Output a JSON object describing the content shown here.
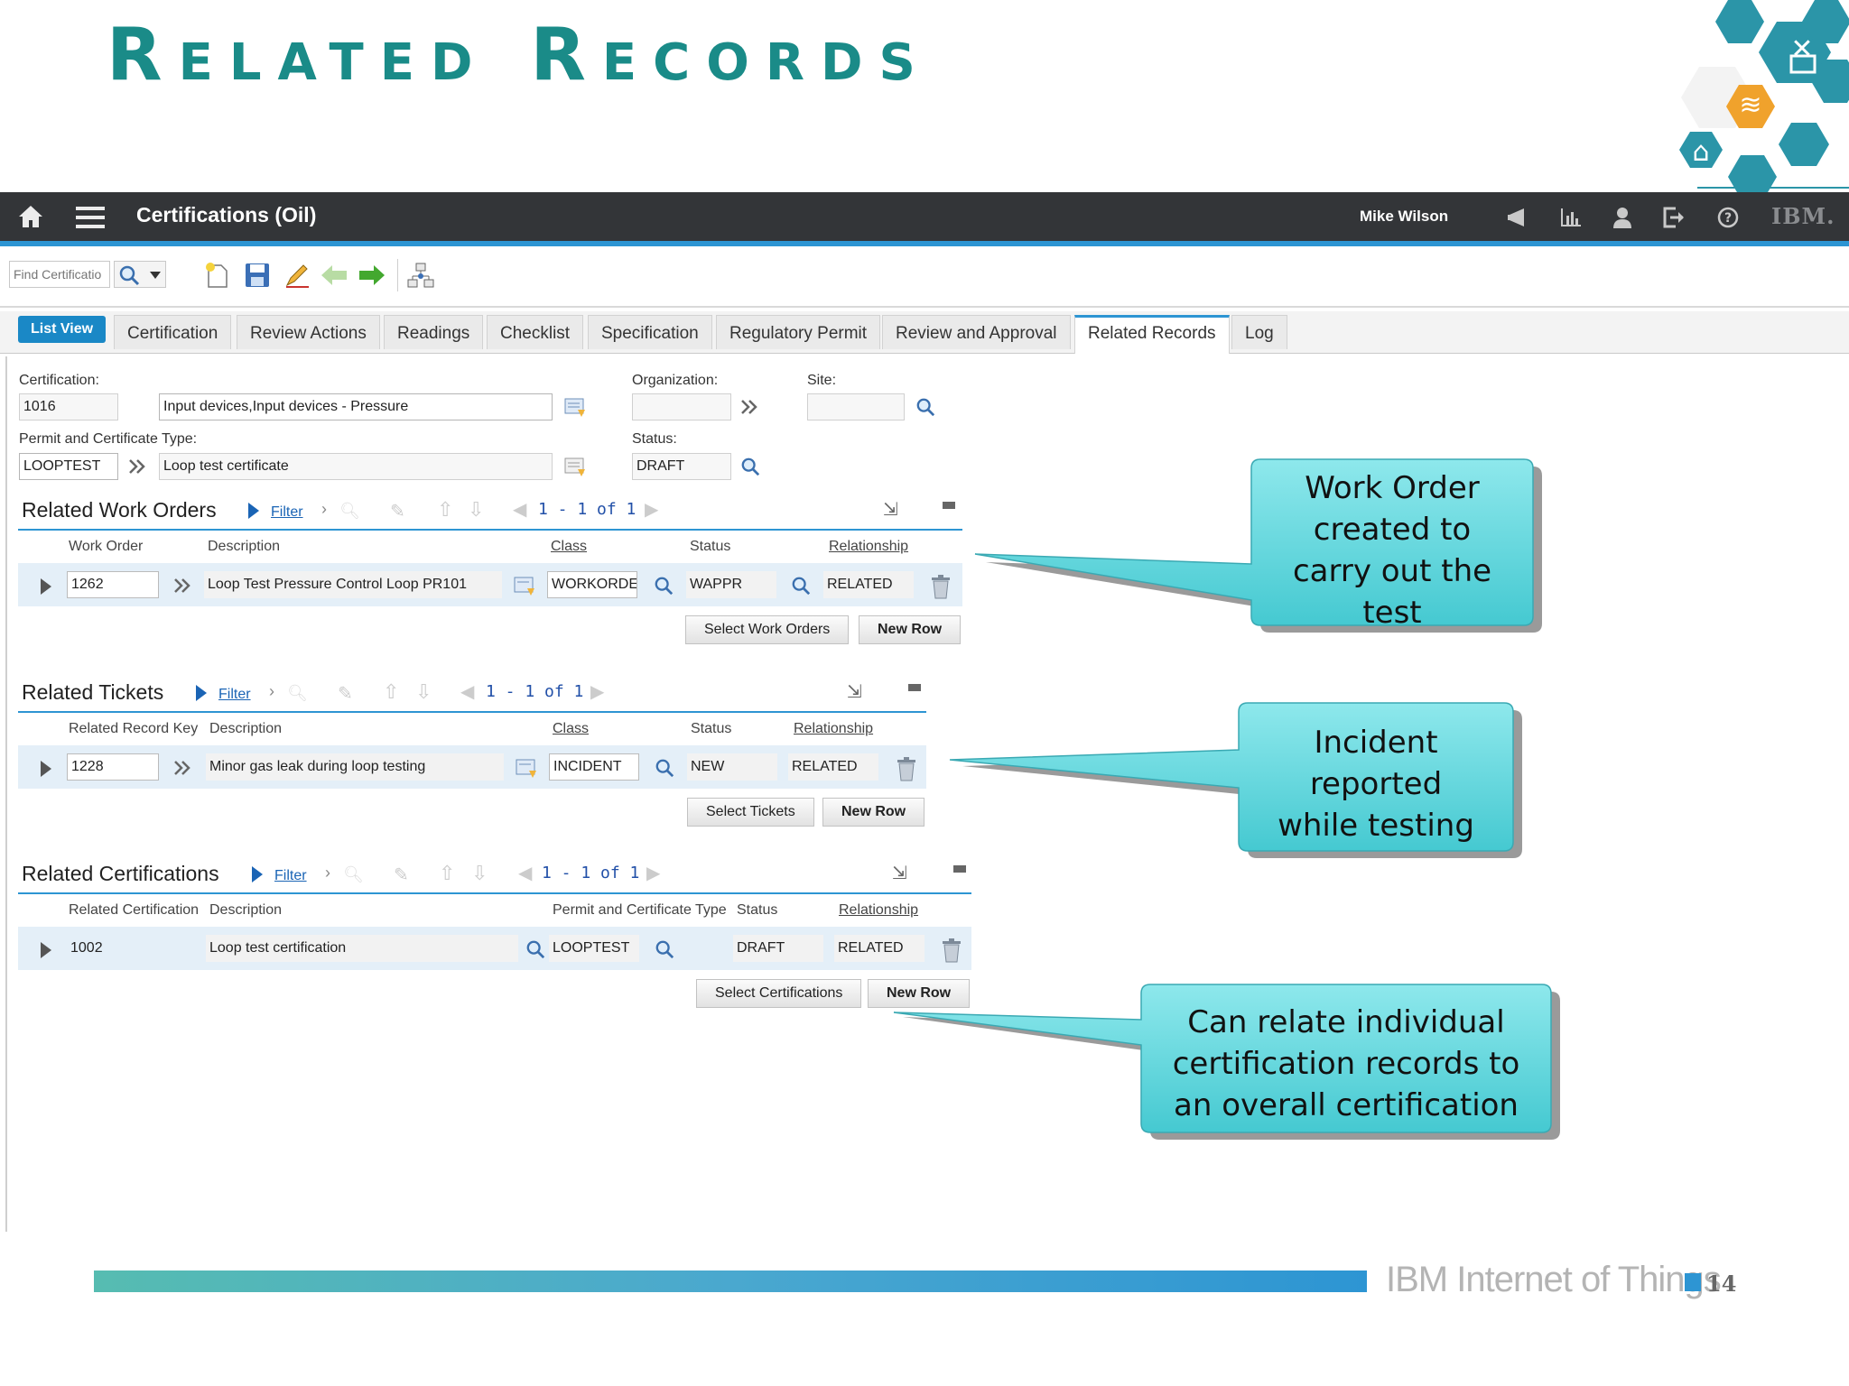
{
  "slide": {
    "title": "Related Records"
  },
  "app": {
    "title": "Certifications (Oil)",
    "user": "Mike Wilson",
    "ibm_logo": "IBM."
  },
  "toolbar": {
    "find_placeholder": "Find Certificatio"
  },
  "tabs": {
    "list_view": "List View",
    "items": [
      "Certification",
      "Review Actions",
      "Readings",
      "Checklist",
      "Specification",
      "Regulatory Permit",
      "Review and Approval",
      "Related Records",
      "Log"
    ],
    "active": "Related Records"
  },
  "form": {
    "certification_label": "Certification:",
    "certification_value": "1016",
    "description_value": "Input devices,Input devices - Pressure",
    "organization_label": "Organization:",
    "organization_value": "",
    "site_label": "Site:",
    "site_value": "",
    "permit_label": "Permit and Certificate Type:",
    "permit_value": "LOOPTEST",
    "permit_desc": "Loop test certificate",
    "status_label": "Status:",
    "status_value": "DRAFT"
  },
  "work_orders": {
    "title": "Related Work Orders",
    "filter": "Filter",
    "pager": "1 - 1 of 1",
    "columns": [
      "Work Order",
      "Description",
      "Class",
      "Status",
      "Relationship"
    ],
    "row": {
      "key": "1262",
      "description": "Loop Test Pressure Control Loop PR101",
      "class": "WORKORDE",
      "status": "WAPPR",
      "relationship": "RELATED"
    },
    "select_btn": "Select Work Orders",
    "new_row_btn": "New Row"
  },
  "tickets": {
    "title": "Related Tickets",
    "filter": "Filter",
    "pager": "1 - 1 of 1",
    "columns": [
      "Related Record Key",
      "Description",
      "Class",
      "Status",
      "Relationship"
    ],
    "row": {
      "key": "1228",
      "description": "Minor gas leak during loop testing",
      "class": "INCIDENT",
      "status": "NEW",
      "relationship": "RELATED"
    },
    "select_btn": "Select Tickets",
    "new_row_btn": "New Row"
  },
  "certifications": {
    "title": "Related Certifications",
    "filter": "Filter",
    "pager": "1 - 1 of 1",
    "columns": [
      "Related Certification",
      "Description",
      "Permit and Certificate Type",
      "Status",
      "Relationship"
    ],
    "row": {
      "key": "1002",
      "description": "Loop test certification",
      "type": "LOOPTEST",
      "status": "DRAFT",
      "relationship": "RELATED"
    },
    "select_btn": "Select Certifications",
    "new_row_btn": "New Row"
  },
  "callouts": {
    "work_order": [
      "Work Order",
      "created to",
      "carry out the",
      "test"
    ],
    "incident": [
      "Incident",
      "reported",
      "while testing"
    ],
    "certification": [
      "Can relate individual",
      "certification records to",
      "an overall certification"
    ]
  },
  "footer": {
    "brand": "IBM Internet of Things",
    "page": "14"
  },
  "colors": {
    "accent": "#2d95d3",
    "title_teal": "#1a8b88",
    "callout_fill": "#5fd6dc",
    "appbar": "#333538",
    "hex_teal": "#2b95a8",
    "hex_orange": "#f0a22c"
  }
}
